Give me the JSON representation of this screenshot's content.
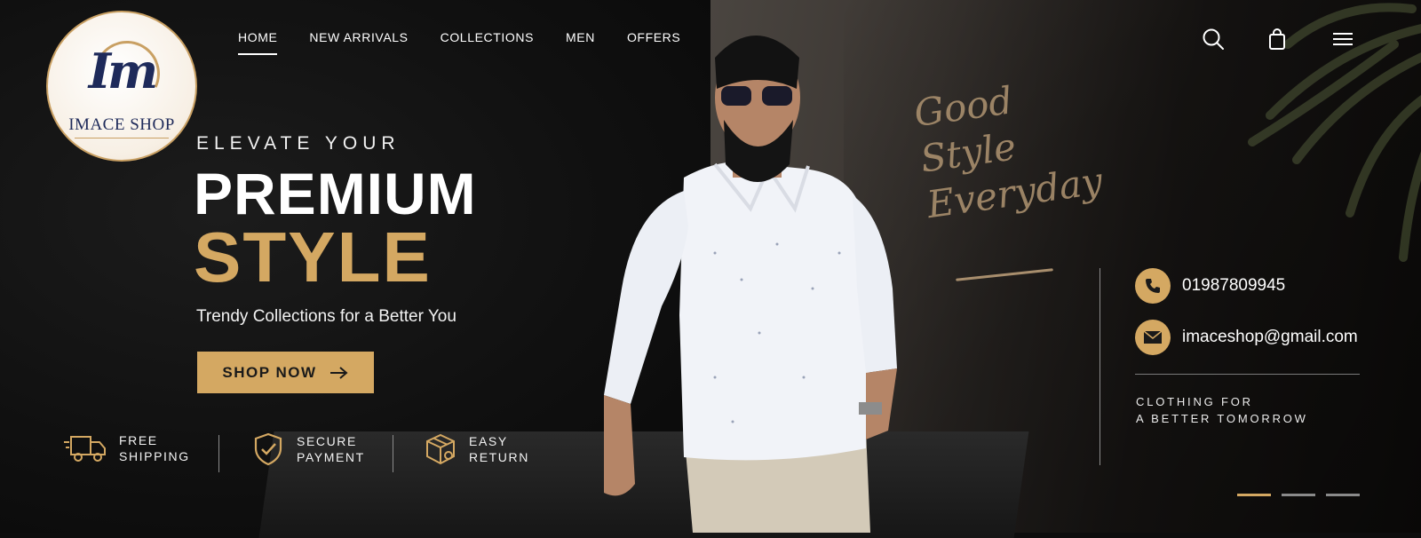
{
  "brand": {
    "logo_mark": "Im",
    "name": "IMACE SHOP"
  },
  "nav": {
    "items": [
      "HOME",
      "NEW ARRIVALS",
      "COLLECTIONS",
      "MEN",
      "OFFERS"
    ],
    "active_index": 0
  },
  "header_icons": [
    "search-icon",
    "shopping-bag-icon",
    "menu-icon"
  ],
  "hero": {
    "eyebrow": "ELEVATE YOUR",
    "title_line1": "PREMIUM",
    "title_line2": "STYLE",
    "subtitle": "Trendy Collections for a Better You",
    "cta_label": "SHOP NOW"
  },
  "features": [
    {
      "icon": "delivery-truck-icon",
      "line1": "FREE",
      "line2": "SHIPPING"
    },
    {
      "icon": "shield-check-icon",
      "line1": "SECURE",
      "line2": "PAYMENT"
    },
    {
      "icon": "box-return-icon",
      "line1": "EASY",
      "line2": "RETURN"
    }
  ],
  "script_text": {
    "line1": "Good",
    "line2": "Style",
    "line3": "Everyday"
  },
  "contact": {
    "phone": "01987809945",
    "email": "imaceshop@gmail.com",
    "tagline_line1": "CLOTHING FOR",
    "tagline_line2": "A BETTER TOMORROW"
  },
  "slider": {
    "count": 3,
    "active_index": 0
  },
  "colors": {
    "accent": "#d4a862",
    "background": "#0d0d0d",
    "logo_navy": "#1e2a5a"
  }
}
